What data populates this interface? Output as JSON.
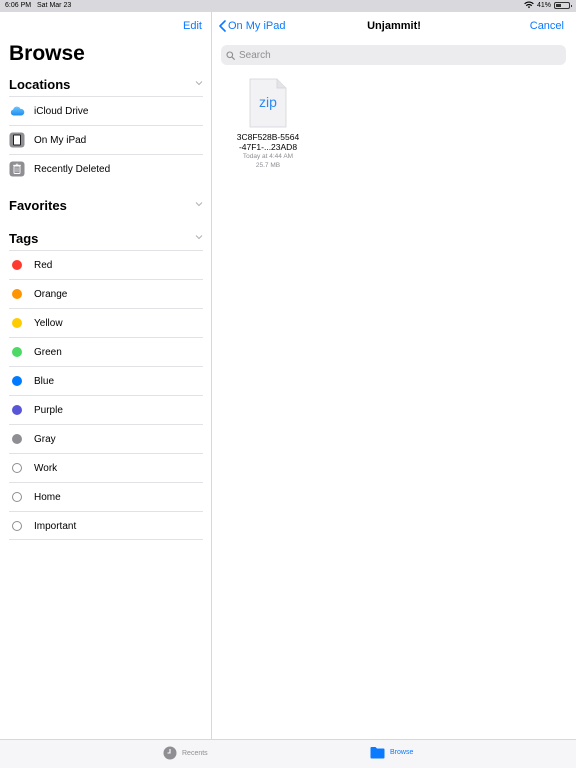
{
  "status_bar": {
    "time": "6:06 PM",
    "date": "Sat Mar 23",
    "battery_text": "41%",
    "battery_level": 0.41
  },
  "sidebar": {
    "edit_label": "Edit",
    "title": "Browse",
    "locations_header": "Locations",
    "locations": [
      {
        "label": "iCloud Drive",
        "icon": "icloud-icon"
      },
      {
        "label": "On My iPad",
        "icon": "ipad-icon"
      },
      {
        "label": "Recently Deleted",
        "icon": "trash-icon"
      }
    ],
    "favorites_header": "Favorites",
    "tags_header": "Tags",
    "tags": [
      {
        "label": "Red",
        "color": "#ff3b30"
      },
      {
        "label": "Orange",
        "color": "#ff9500"
      },
      {
        "label": "Yellow",
        "color": "#ffcc00"
      },
      {
        "label": "Green",
        "color": "#4cd964"
      },
      {
        "label": "Blue",
        "color": "#007aff"
      },
      {
        "label": "Purple",
        "color": "#5856d6"
      },
      {
        "label": "Gray",
        "color": "#8e8e93"
      },
      {
        "label": "Work",
        "color": ""
      },
      {
        "label": "Home",
        "color": ""
      },
      {
        "label": "Important",
        "color": ""
      }
    ]
  },
  "content": {
    "back_label": "On My iPad",
    "title": "Unjammit!",
    "cancel_label": "Cancel",
    "search_placeholder": "Search",
    "file": {
      "type_label": "zip",
      "name_line1": "3C8F528B-5564",
      "name_line2": "-47F1-...23AD8",
      "date": "Today at 4:44 AM",
      "size": "25.7 MB"
    }
  },
  "tabbar": {
    "recents_label": "Recents",
    "browse_label": "Browse"
  },
  "colors": {
    "accent": "#0a7aff"
  }
}
